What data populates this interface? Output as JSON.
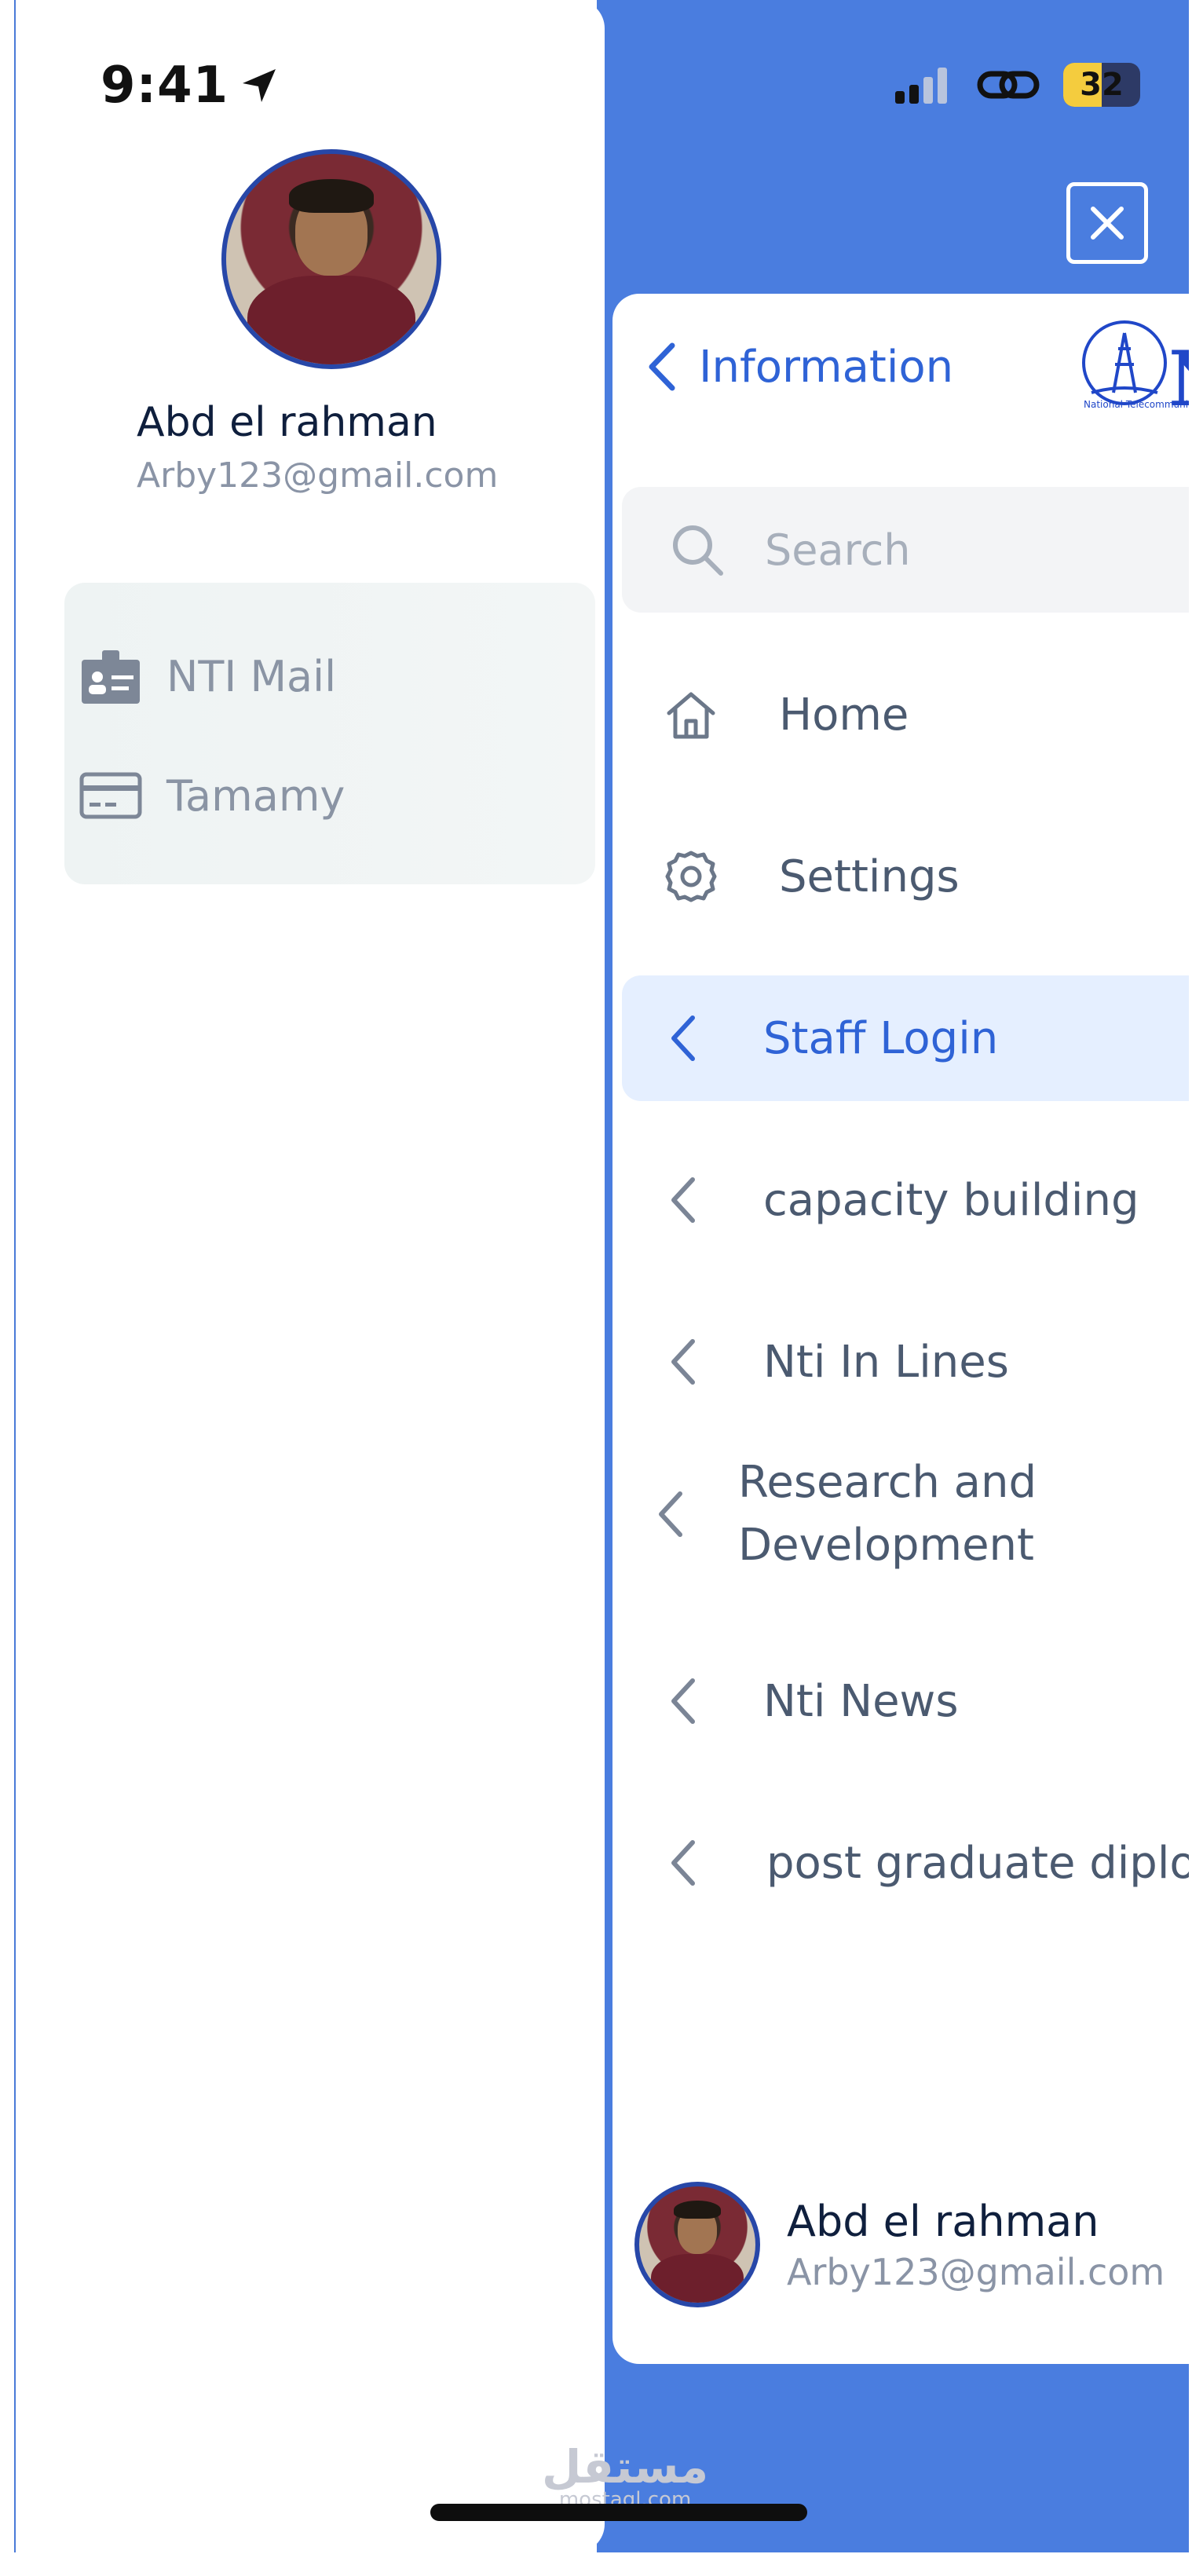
{
  "status_bar": {
    "time": "9:41",
    "battery": "32"
  },
  "drawer": {
    "user": {
      "name": "Abd el rahman",
      "email": "Arby123@gmail.com"
    },
    "menu": [
      {
        "label": "NTI Mail",
        "icon": "id-badge-icon"
      },
      {
        "label": "Tamamy",
        "icon": "credit-card-icon"
      }
    ]
  },
  "panel": {
    "header_title": "Information",
    "logo": {
      "text": "NTI",
      "subtext": "National Telecommunication Institute"
    },
    "search": {
      "placeholder": "Search"
    },
    "nav": [
      {
        "label": "Home",
        "icon": "home-icon"
      },
      {
        "label": "Settings",
        "icon": "gear-icon"
      },
      {
        "label": "Staff Login",
        "icon": "chevron-left-icon",
        "active": true
      },
      {
        "label": "capacity building",
        "icon": "chevron-left-icon"
      },
      {
        "label": "Nti In Lines",
        "icon": "chevron-left-icon"
      },
      {
        "label": "Research and Development",
        "icon": "chevron-left-icon"
      },
      {
        "label": "Nti News",
        "icon": "chevron-left-icon"
      },
      {
        "label": "post graduate diplom",
        "icon": "chevron-left-icon"
      }
    ],
    "user": {
      "name": "Abd el rahman",
      "email": "Arby123@gmail.com"
    }
  },
  "watermark": {
    "arabic": "مستقل",
    "latin": "mostaql.com"
  },
  "colors": {
    "accent": "#2f63d6",
    "background_blue": "#4a7ddf",
    "active_bg": "#e5efff",
    "text_muted": "#8a94a6"
  }
}
